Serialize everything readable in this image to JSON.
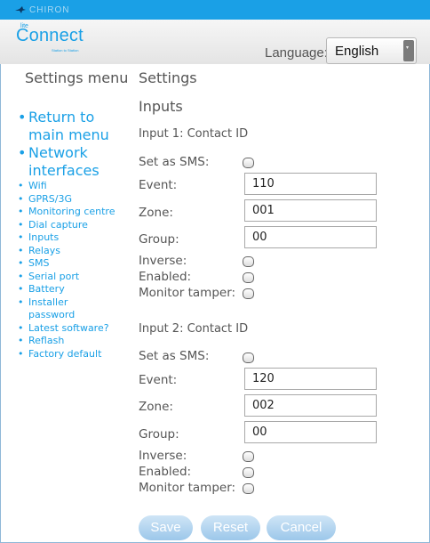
{
  "topbar": {
    "brand": "CHIRON"
  },
  "header": {
    "logo_small": "lite",
    "logo_big": "Connect",
    "logo_tagline": "Station to Station",
    "language_label": "Language:",
    "language_value": "English"
  },
  "sidebar": {
    "title": "Settings menu",
    "items": [
      {
        "label": "Return to main menu",
        "size": "large"
      },
      {
        "label": "Network interfaces",
        "size": "large"
      },
      {
        "label": "Wifi",
        "size": "small"
      },
      {
        "label": "GPRS/3G",
        "size": "small"
      },
      {
        "label": "Monitoring centre",
        "size": "small"
      },
      {
        "label": "Dial capture",
        "size": "small"
      },
      {
        "label": "Inputs",
        "size": "small"
      },
      {
        "label": "Relays",
        "size": "small"
      },
      {
        "label": "SMS",
        "size": "small"
      },
      {
        "label": "Serial port",
        "size": "small"
      },
      {
        "label": "Battery",
        "size": "small"
      },
      {
        "label": "Installer password",
        "size": "small"
      },
      {
        "label": "Latest software?",
        "size": "small"
      },
      {
        "label": "Reflash",
        "size": "small"
      },
      {
        "label": "Factory default",
        "size": "small"
      }
    ]
  },
  "main": {
    "title": "Settings",
    "section": "Inputs",
    "inputs": [
      {
        "heading": "Input 1: Contact ID",
        "set_as_sms_label": "Set as SMS:",
        "event_label": "Event:",
        "event_value": "110",
        "zone_label": "Zone:",
        "zone_value": "001",
        "group_label": "Group:",
        "group_value": "00",
        "inverse_label": "Inverse:",
        "enabled_label": "Enabled:",
        "monitor_tamper_label": "Monitor tamper:"
      },
      {
        "heading": "Input 2: Contact ID",
        "set_as_sms_label": "Set as SMS:",
        "event_label": "Event:",
        "event_value": "120",
        "zone_label": "Zone:",
        "zone_value": "002",
        "group_label": "Group:",
        "group_value": "00",
        "inverse_label": "Inverse:",
        "enabled_label": "Enabled:",
        "monitor_tamper_label": "Monitor tamper:"
      }
    ]
  },
  "actions": {
    "save": "Save",
    "reset": "Reset",
    "cancel": "Cancel"
  },
  "colors": {
    "accent": "#1aa0e6",
    "button": "#a9cff0"
  }
}
